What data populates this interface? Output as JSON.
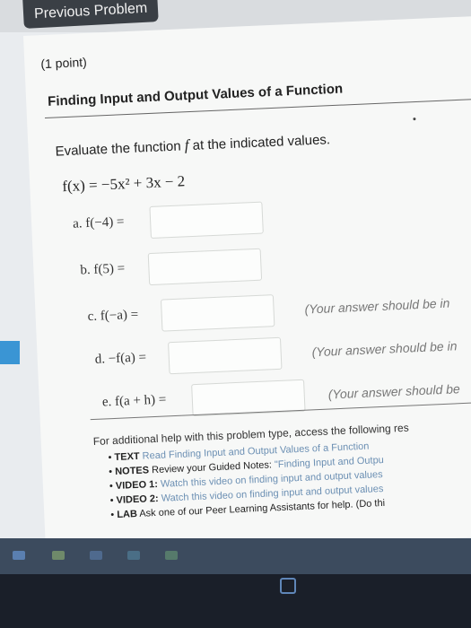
{
  "header": {
    "prev_label": "Previous Problem"
  },
  "problem": {
    "points": "(1 point)",
    "title": "Finding Input and Output Values of a Function",
    "instruction_before": "Evaluate the function",
    "instruction_var": "f",
    "instruction_after": "at the indicated values.",
    "function_def": "f(x) = −5x² + 3x − 2"
  },
  "parts": [
    {
      "label": "a.  f(−4) =",
      "hint": ""
    },
    {
      "label": "b.  f(5) =",
      "hint": ""
    },
    {
      "label": "c.  f(−a) =",
      "hint": "(Your answer should be in"
    },
    {
      "label": "d.  −f(a) =",
      "hint": "(Your answer should be in"
    },
    {
      "label": "e.  f(a + h) =",
      "hint": "(Your answer should be"
    }
  ],
  "help": {
    "intro": "For additional help with this problem type, access the following res",
    "items": [
      {
        "type": "TEXT",
        "pre": "",
        "link": "Read Finding Input and Output Values of a Function"
      },
      {
        "type": "NOTES",
        "pre": "Review your Guided Notes: ",
        "link": "\"Finding Input and Outpu"
      },
      {
        "type": "VIDEO 1:",
        "pre": "",
        "link": "Watch this video on finding input and output values"
      },
      {
        "type": "VIDEO 2:",
        "pre": "",
        "link": "Watch this video on finding input and output values"
      },
      {
        "type": "LAB",
        "pre": "Ask one of our Peer Learning Assistants for help. (Do thi",
        "link": ""
      }
    ]
  },
  "colors": {
    "accent": "#3a95d4",
    "taskbar": "#1a1f29",
    "button": "#3a3f45"
  }
}
